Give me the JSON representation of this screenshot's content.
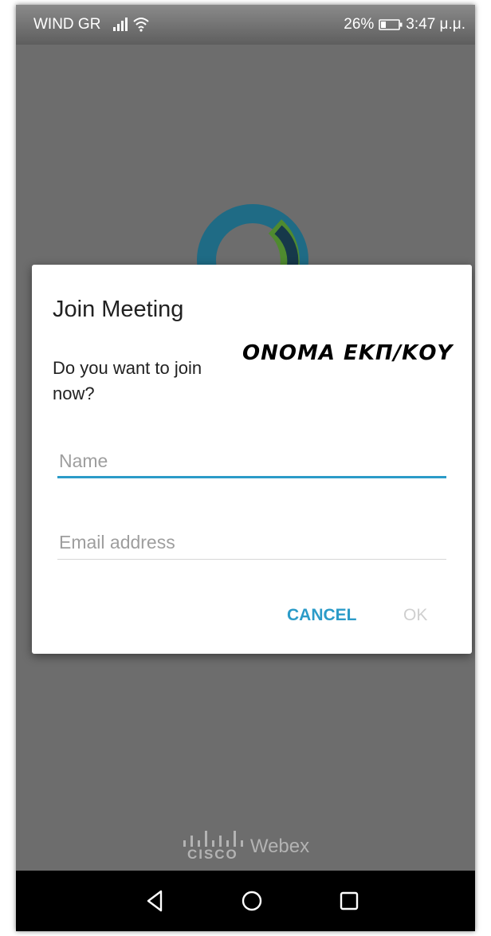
{
  "status_bar": {
    "carrier": "WIND GR",
    "battery_percent": "26%",
    "time": "3:47 μ.μ.",
    "icons": [
      "signal-icon",
      "wifi-icon",
      "battery-icon"
    ]
  },
  "dialog": {
    "title": "Join Meeting",
    "message": "Do you want to join now?",
    "annotation": "ONOMA ΕΚΠ/ΚΟΥ",
    "name_input": {
      "value": "",
      "placeholder": "Name"
    },
    "email_input": {
      "value": "",
      "placeholder": "Email address"
    },
    "cancel_label": "CANCEL",
    "ok_label": "OK"
  },
  "brand": {
    "cisco": "CISCO",
    "product": "Webex"
  },
  "nav": {
    "icons": [
      "back-icon",
      "home-icon",
      "recent-apps-icon"
    ]
  },
  "colors": {
    "accent": "#2b9bc8",
    "dim_background": "#6d6d6d",
    "logo_teal": "#1f6b85",
    "logo_green": "#4f8a2f"
  }
}
